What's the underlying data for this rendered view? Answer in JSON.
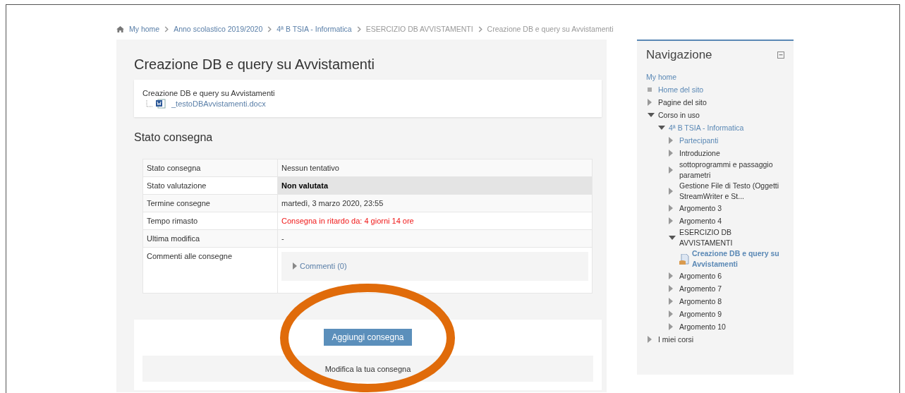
{
  "breadcrumb": [
    {
      "label": "My home",
      "link": true
    },
    {
      "label": "Anno scolastico 2019/2020",
      "link": true
    },
    {
      "label": "4ª B TSIA - Informatica",
      "link": true
    },
    {
      "label": "ESERCIZIO DB AVVISTAMENTI",
      "link": false
    },
    {
      "label": "Creazione DB e query su Avvistamenti",
      "link": false
    }
  ],
  "page_title": "Creazione DB e query su Avvistamenti",
  "intro": {
    "text": "Creazione DB e query su Avvistamenti",
    "file": "_testoDBAvvistamenti.docx"
  },
  "status_heading": "Stato consegna",
  "status_table": [
    {
      "label": "Stato consegna",
      "value": "Nessun tentativo",
      "kind": "text",
      "highlight": false,
      "overdue": false
    },
    {
      "label": "Stato valutazione",
      "value": "Non valutata",
      "kind": "text",
      "highlight": true,
      "overdue": false
    },
    {
      "label": "Termine consegne",
      "value": "martedì, 3 marzo 2020, 23:55",
      "kind": "text",
      "highlight": false,
      "overdue": false
    },
    {
      "label": "Tempo rimasto",
      "value": "Consegna in ritardo da: 4 giorni 14 ore",
      "kind": "text",
      "highlight": false,
      "overdue": true
    },
    {
      "label": "Ultima modifica",
      "value": "-",
      "kind": "text",
      "highlight": false,
      "overdue": false
    },
    {
      "label": "Commenti alle consegne",
      "value": "Commenti (0)",
      "kind": "comments"
    }
  ],
  "submit_button": "Aggiungi consegna",
  "edit_note": "Modifica la tua consegna",
  "navigation": {
    "title": "Navigazione",
    "items": [
      {
        "label": "My home",
        "kind": "plain",
        "link": true
      },
      {
        "label": "Home del sito",
        "kind": "page",
        "link": true
      },
      {
        "label": "Pagine del sito",
        "kind": "branch",
        "link": false,
        "expanded": false
      },
      {
        "label": "Corso in uso",
        "kind": "branch",
        "link": false,
        "expanded": true,
        "children": [
          {
            "label": "4ª B TSIA - Informatica",
            "kind": "branch",
            "link": true,
            "expanded": true,
            "children": [
              {
                "label": "Partecipanti",
                "kind": "branch",
                "link": true,
                "expanded": false
              },
              {
                "label": "Introduzione",
                "kind": "branch",
                "link": false,
                "expanded": false
              },
              {
                "label": "sottoprogrammi e passaggio parametri",
                "kind": "branch",
                "link": false,
                "expanded": false
              },
              {
                "label": "Gestione File di Testo (Oggetti StreamWriter e St...",
                "kind": "branch",
                "link": false,
                "expanded": false
              },
              {
                "label": "Argomento 3",
                "kind": "branch",
                "link": false,
                "expanded": false
              },
              {
                "label": "Argomento 4",
                "kind": "branch",
                "link": false,
                "expanded": false
              },
              {
                "label": "ESERCIZIO DB AVVISTAMENTI",
                "kind": "branch",
                "link": false,
                "expanded": true,
                "children": [
                  {
                    "label": "Creazione DB e query su Avvistamenti",
                    "kind": "activity",
                    "link": true
                  }
                ]
              },
              {
                "label": "Argomento 6",
                "kind": "branch",
                "link": false,
                "expanded": false
              },
              {
                "label": "Argomento 7",
                "kind": "branch",
                "link": false,
                "expanded": false
              },
              {
                "label": "Argomento 8",
                "kind": "branch",
                "link": false,
                "expanded": false
              },
              {
                "label": "Argomento 9",
                "kind": "branch",
                "link": false,
                "expanded": false
              },
              {
                "label": "Argomento 10",
                "kind": "branch",
                "link": false,
                "expanded": false
              }
            ]
          }
        ]
      },
      {
        "label": "I miei corsi",
        "kind": "branch",
        "link": false,
        "expanded": false
      }
    ]
  }
}
